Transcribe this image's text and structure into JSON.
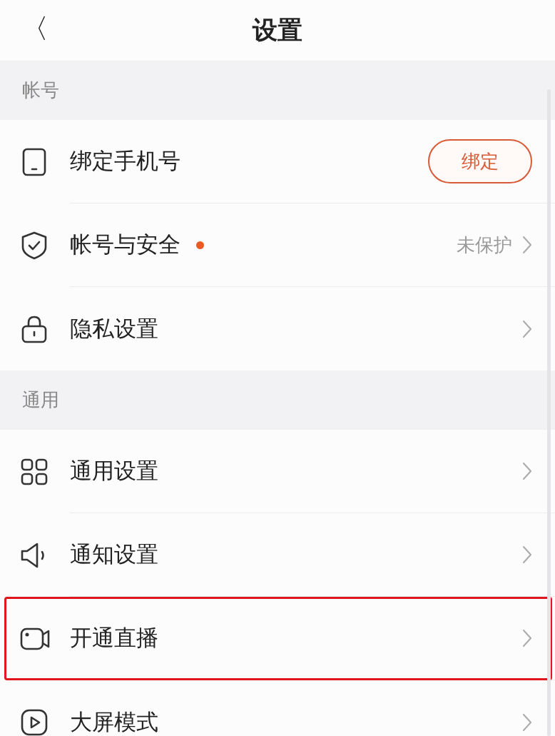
{
  "header": {
    "back": "〈",
    "title": "设置"
  },
  "sections": [
    {
      "title": "帐号",
      "items": [
        {
          "label": "绑定手机号",
          "kind": "button",
          "action": "绑定",
          "badge": false,
          "highlighted": false
        },
        {
          "label": "帐号与安全",
          "kind": "value",
          "value": "未保护",
          "badge": true,
          "highlighted": false
        },
        {
          "label": "隐私设置",
          "kind": "link",
          "badge": false,
          "highlighted": false
        }
      ]
    },
    {
      "title": "通用",
      "items": [
        {
          "label": "通用设置",
          "kind": "link",
          "badge": false,
          "highlighted": false
        },
        {
          "label": "通知设置",
          "kind": "link",
          "badge": false,
          "highlighted": false
        },
        {
          "label": "开通直播",
          "kind": "link",
          "badge": false,
          "highlighted": true
        },
        {
          "label": "大屏模式",
          "kind": "link",
          "badge": false,
          "highlighted": false
        }
      ]
    }
  ]
}
